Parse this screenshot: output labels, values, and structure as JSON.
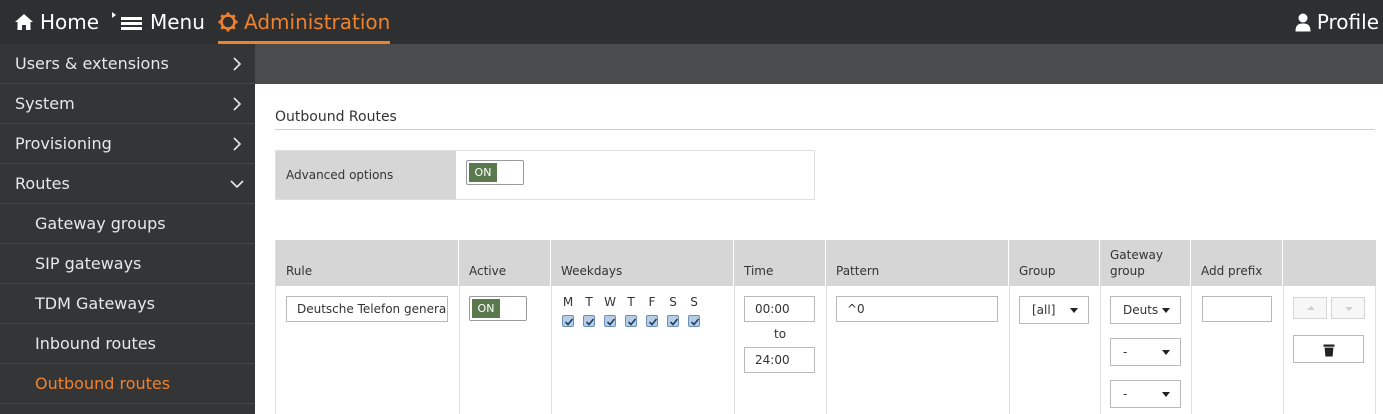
{
  "topnav": {
    "home": "Home",
    "menu": "Menu",
    "admin": "Administration",
    "profile": "Profile"
  },
  "sidebar": {
    "items": [
      {
        "label": "Users & extensions"
      },
      {
        "label": "System"
      },
      {
        "label": "Provisioning"
      },
      {
        "label": "Routes"
      }
    ],
    "routes_sub": [
      {
        "label": "Gateway groups"
      },
      {
        "label": "SIP gateways"
      },
      {
        "label": "TDM Gateways"
      },
      {
        "label": "Inbound routes"
      },
      {
        "label": "Outbound routes"
      }
    ]
  },
  "page": {
    "title": "Outbound Routes",
    "advanced_label": "Advanced options",
    "advanced_toggle": "ON"
  },
  "table": {
    "headers": {
      "rule": "Rule",
      "active": "Active",
      "weekdays": "Weekdays",
      "time": "Time",
      "pattern": "Pattern",
      "group": "Group",
      "gateway_group": "Gateway group",
      "add_prefix": "Add prefix"
    },
    "row": {
      "rule": "Deutsche Telefon general",
      "active": "ON",
      "weekdays": [
        "M",
        "T",
        "W",
        "T",
        "F",
        "S",
        "S"
      ],
      "time_from": "00:00",
      "time_to_label": "to",
      "time_to": "24:00",
      "pattern": "^0",
      "group": "[all]",
      "gateway_group_1": "Deuts",
      "gateway_group_2": "-",
      "gateway_group_3": "-",
      "add_prefix": ""
    }
  },
  "colors": {
    "accent": "#f0822d",
    "toggle_on": "#5a7a4e",
    "topbar": "#2e2f30",
    "sidebar": "#343536"
  },
  "icons": {
    "home": "home-icon",
    "menu": "menu-icon",
    "admin": "gear-icon",
    "profile": "user-icon",
    "delete": "trash-icon"
  }
}
